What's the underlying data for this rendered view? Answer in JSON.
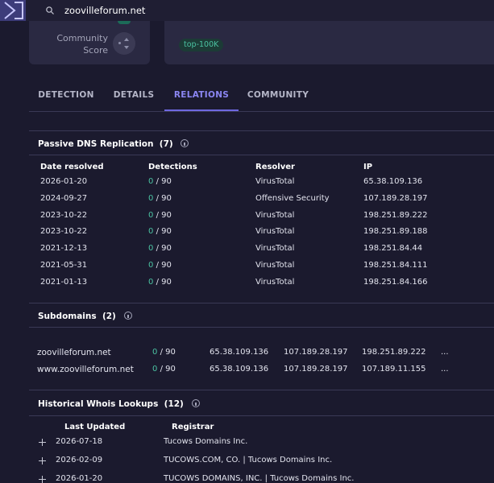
{
  "search": {
    "value": "zoovilleforum.net"
  },
  "header": {
    "score_label": "Community Score",
    "tag": "top-100K"
  },
  "tabs": [
    {
      "label": "DETECTION"
    },
    {
      "label": "DETAILS"
    },
    {
      "label": "RELATIONS"
    },
    {
      "label": "COMMUNITY"
    }
  ],
  "active_tab": "RELATIONS",
  "passive_dns": {
    "title": "Passive DNS Replication",
    "count": "(7)",
    "headers": [
      "Date resolved",
      "Detections",
      "Resolver",
      "IP"
    ],
    "rows": [
      {
        "date": "2026-01-20",
        "det_zero": "0",
        "det_total": "/ 90",
        "resolver": "VirusTotal",
        "ip": "65.38.109.136"
      },
      {
        "date": "2024-09-27",
        "det_zero": "0",
        "det_total": "/ 90",
        "resolver": "Offensive Security",
        "ip": "107.189.28.197"
      },
      {
        "date": "2023-10-22",
        "det_zero": "0",
        "det_total": "/ 90",
        "resolver": "VirusTotal",
        "ip": "198.251.89.222"
      },
      {
        "date": "2023-10-22",
        "det_zero": "0",
        "det_total": "/ 90",
        "resolver": "VirusTotal",
        "ip": "198.251.89.188"
      },
      {
        "date": "2021-12-13",
        "det_zero": "0",
        "det_total": "/ 90",
        "resolver": "VirusTotal",
        "ip": "198.251.84.44"
      },
      {
        "date": "2021-05-31",
        "det_zero": "0",
        "det_total": "/ 90",
        "resolver": "VirusTotal",
        "ip": "198.251.84.111"
      },
      {
        "date": "2021-01-13",
        "det_zero": "0",
        "det_total": "/ 90",
        "resolver": "VirusTotal",
        "ip": "198.251.84.166"
      }
    ]
  },
  "subdomains": {
    "title": "Subdomains",
    "count": "(2)",
    "rows": [
      {
        "domain": "zoovilleforum.net",
        "det_zero": "0",
        "det_total": "/ 90",
        "ip1": "65.38.109.136",
        "ip2": "107.189.28.197",
        "ip3": "198.251.89.222",
        "more": "..."
      },
      {
        "domain": "www.zoovilleforum.net",
        "det_zero": "0",
        "det_total": "/ 90",
        "ip1": "65.38.109.136",
        "ip2": "107.189.28.197",
        "ip3": "107.189.11.155",
        "more": "..."
      }
    ]
  },
  "whois": {
    "title": "Historical Whois Lookups",
    "count": "(12)",
    "headers": [
      "Last Updated",
      "Registrar"
    ],
    "rows": [
      {
        "date": "2026-07-18",
        "registrar": "Tucows Domains Inc."
      },
      {
        "date": "2026-02-09",
        "registrar": "TUCOWS.COM, CO. | Tucows Domains Inc."
      },
      {
        "date": "2026-01-20",
        "registrar": "TUCOWS DOMAINS, INC. | Tucows Domains Inc."
      }
    ]
  },
  "colors": {
    "background": "#1b1a2e",
    "accent": "#6e68e0",
    "clean": "#4bc3a2",
    "card": "#2a2942"
  }
}
